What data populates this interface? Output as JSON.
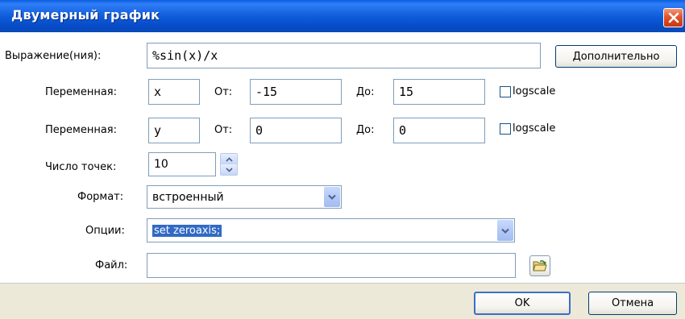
{
  "window": {
    "title": "Двумерный график"
  },
  "expression": {
    "label": "Выражение(ния):",
    "value": "%sin(x)/x",
    "more_button": "Дополнительно"
  },
  "var1": {
    "label": "Переменная:",
    "value": "x",
    "from_label": "От:",
    "from": "-15",
    "to_label": "До:",
    "to": "15",
    "logscale": "logscale"
  },
  "var2": {
    "label": "Переменная:",
    "value": "y",
    "from_label": "От:",
    "from": "0",
    "to_label": "До:",
    "to": "0",
    "logscale": "logscale"
  },
  "points": {
    "label": "Число точек:",
    "value": "10"
  },
  "format": {
    "label": "Формат:",
    "value": "встроенный"
  },
  "options": {
    "label": "Опции:",
    "value": "set zeroaxis;"
  },
  "file": {
    "label": "Файл:",
    "value": ""
  },
  "footer": {
    "ok": "OK",
    "cancel": "Отмена"
  },
  "colors": {
    "titlebar": "#0a5fe0",
    "selection": "#316ac5",
    "footer": "#ece9d8"
  }
}
